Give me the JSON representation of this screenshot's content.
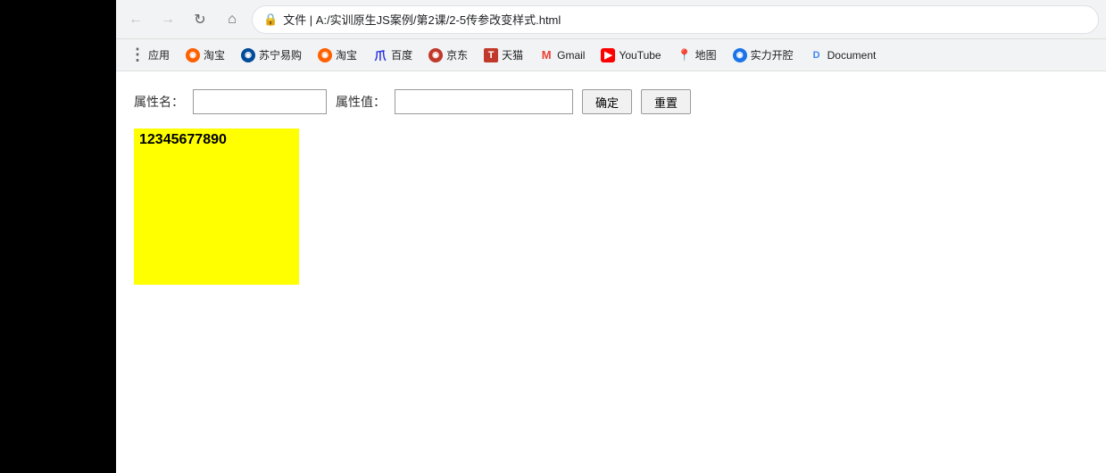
{
  "browser": {
    "back_title": "后退",
    "forward_title": "前进",
    "refresh_title": "刷新",
    "home_title": "主页",
    "address": "文件 | A:/实训原生JS案例/第2课/2-5传参改变样式.html",
    "security_icon": "🔒"
  },
  "bookmarks": [
    {
      "id": "apps",
      "label": "应用",
      "icon": "⋮⋮⋮",
      "icon_type": "apps"
    },
    {
      "id": "taobao1",
      "label": "淘宝",
      "icon": "◎",
      "icon_type": "taobao"
    },
    {
      "id": "suning",
      "label": "苏宁易购",
      "icon": "◎",
      "icon_type": "suning"
    },
    {
      "id": "taobao2",
      "label": "淘宝",
      "icon": "◎",
      "icon_type": "taobao2"
    },
    {
      "id": "baidu",
      "label": "百度",
      "icon": "爪",
      "icon_type": "baidu"
    },
    {
      "id": "jingdong",
      "label": "京东",
      "icon": "◎",
      "icon_type": "jingdong"
    },
    {
      "id": "tmall",
      "label": "天猫",
      "icon": "T",
      "icon_type": "tmall"
    },
    {
      "id": "gmail",
      "label": "Gmail",
      "icon": "M",
      "icon_type": "gmail"
    },
    {
      "id": "youtube",
      "label": "YouTube",
      "icon": "▶",
      "icon_type": "youtube"
    },
    {
      "id": "ditu",
      "label": "地图",
      "icon": "📍",
      "icon_type": "ditu"
    },
    {
      "id": "shili",
      "label": "实力开腔",
      "icon": "◎",
      "icon_type": "shili"
    },
    {
      "id": "doc",
      "label": "Document",
      "icon": "D",
      "icon_type": "doc"
    }
  ],
  "toolbar": {
    "attr_name_label": "属性名：",
    "attr_value_label": "属性值：",
    "confirm_label": "确定",
    "reset_label": "重置",
    "attr_name_placeholder": "",
    "attr_value_placeholder": ""
  },
  "demo": {
    "text": "12345677890",
    "bg_color": "#ffff00"
  }
}
